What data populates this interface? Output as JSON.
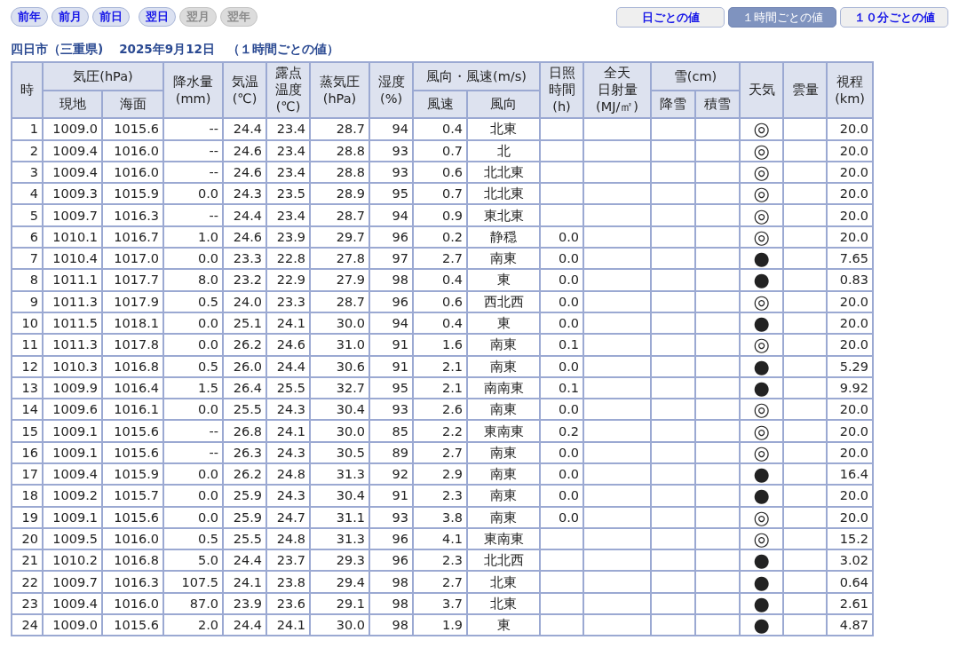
{
  "nav_buttons": [
    {
      "label": "前年",
      "disabled": false
    },
    {
      "label": "前月",
      "disabled": false
    },
    {
      "label": "前日",
      "disabled": false
    },
    {
      "label": "翌日",
      "disabled": false
    },
    {
      "label": "翌月",
      "disabled": true
    },
    {
      "label": "翌年",
      "disabled": true
    }
  ],
  "view_tabs": [
    {
      "label": "日ごとの値",
      "selected": false
    },
    {
      "label": "１時間ごとの値",
      "selected": true
    },
    {
      "label": "１０分ごとの値",
      "selected": false
    }
  ],
  "heading": {
    "station": "四日市（三重県)",
    "date": "2025年9月12日",
    "note": "（１時間ごとの値）"
  },
  "table": {
    "columns": [
      {
        "label": "時"
      },
      {
        "label": "気圧(hPa)",
        "children": [
          {
            "label": "現地"
          },
          {
            "label": "海面"
          }
        ]
      },
      {
        "label": "降水量(mm)"
      },
      {
        "label": "気温(℃)"
      },
      {
        "label": "露点温度(℃)"
      },
      {
        "label": "蒸気圧(hPa)"
      },
      {
        "label": "湿度(%)"
      },
      {
        "label": "風向・風速(m/s)",
        "children": [
          {
            "label": "風速"
          },
          {
            "label": "風向"
          }
        ]
      },
      {
        "label": "日照時間(h)"
      },
      {
        "label": "全天日射量(MJ/㎡)"
      },
      {
        "label": "雪(cm)",
        "children": [
          {
            "label": "降雪"
          },
          {
            "label": "積雪"
          }
        ]
      },
      {
        "label": "天気"
      },
      {
        "label": "雲量"
      },
      {
        "label": "視程(km)"
      }
    ],
    "rows": [
      {
        "hour": "1",
        "p_station": "1009.0",
        "p_sea": "1015.6",
        "precip": "--",
        "temp": "24.4",
        "dew": "23.4",
        "vapor": "28.7",
        "humidity": "94",
        "wind_speed": "0.4",
        "wind_dir": "北東",
        "weather": "◎",
        "visibility": "20.0"
      },
      {
        "hour": "2",
        "p_station": "1009.4",
        "p_sea": "1016.0",
        "precip": "--",
        "temp": "24.6",
        "dew": "23.4",
        "vapor": "28.8",
        "humidity": "93",
        "wind_speed": "0.7",
        "wind_dir": "北",
        "weather": "◎",
        "visibility": "20.0"
      },
      {
        "hour": "3",
        "p_station": "1009.4",
        "p_sea": "1016.0",
        "precip": "--",
        "temp": "24.6",
        "dew": "23.4",
        "vapor": "28.8",
        "humidity": "93",
        "wind_speed": "0.6",
        "wind_dir": "北北東",
        "weather": "◎",
        "visibility": "20.0"
      },
      {
        "hour": "4",
        "p_station": "1009.3",
        "p_sea": "1015.9",
        "precip": "0.0",
        "temp": "24.3",
        "dew": "23.5",
        "vapor": "28.9",
        "humidity": "95",
        "wind_speed": "0.7",
        "wind_dir": "北北東",
        "weather": "◎",
        "visibility": "20.0"
      },
      {
        "hour": "5",
        "p_station": "1009.7",
        "p_sea": "1016.3",
        "precip": "--",
        "temp": "24.4",
        "dew": "23.4",
        "vapor": "28.7",
        "humidity": "94",
        "wind_speed": "0.9",
        "wind_dir": "東北東",
        "weather": "◎",
        "visibility": "20.0"
      },
      {
        "hour": "6",
        "p_station": "1010.1",
        "p_sea": "1016.7",
        "precip": "1.0",
        "temp": "24.6",
        "dew": "23.9",
        "vapor": "29.7",
        "humidity": "96",
        "wind_speed": "0.2",
        "wind_dir": "静穏",
        "sunshine": "0.0",
        "weather": "◎",
        "visibility": "20.0"
      },
      {
        "hour": "7",
        "p_station": "1010.4",
        "p_sea": "1017.0",
        "precip": "0.0",
        "temp": "23.3",
        "dew": "22.8",
        "vapor": "27.8",
        "humidity": "97",
        "wind_speed": "2.7",
        "wind_dir": "南東",
        "sunshine": "0.0",
        "weather": "●",
        "visibility": "7.65"
      },
      {
        "hour": "8",
        "p_station": "1011.1",
        "p_sea": "1017.7",
        "precip": "8.0",
        "temp": "23.2",
        "dew": "22.9",
        "vapor": "27.9",
        "humidity": "98",
        "wind_speed": "0.4",
        "wind_dir": "東",
        "sunshine": "0.0",
        "weather": "●",
        "visibility": "0.83"
      },
      {
        "hour": "9",
        "p_station": "1011.3",
        "p_sea": "1017.9",
        "precip": "0.5",
        "temp": "24.0",
        "dew": "23.3",
        "vapor": "28.7",
        "humidity": "96",
        "wind_speed": "0.6",
        "wind_dir": "西北西",
        "sunshine": "0.0",
        "weather": "◎",
        "visibility": "20.0"
      },
      {
        "hour": "10",
        "p_station": "1011.5",
        "p_sea": "1018.1",
        "precip": "0.0",
        "temp": "25.1",
        "dew": "24.1",
        "vapor": "30.0",
        "humidity": "94",
        "wind_speed": "0.4",
        "wind_dir": "東",
        "sunshine": "0.0",
        "weather": "●",
        "visibility": "20.0"
      },
      {
        "hour": "11",
        "p_station": "1011.3",
        "p_sea": "1017.8",
        "precip": "0.0",
        "temp": "26.2",
        "dew": "24.6",
        "vapor": "31.0",
        "humidity": "91",
        "wind_speed": "1.6",
        "wind_dir": "南東",
        "sunshine": "0.1",
        "weather": "◎",
        "visibility": "20.0"
      },
      {
        "hour": "12",
        "p_station": "1010.3",
        "p_sea": "1016.8",
        "precip": "0.5",
        "temp": "26.0",
        "dew": "24.4",
        "vapor": "30.6",
        "humidity": "91",
        "wind_speed": "2.1",
        "wind_dir": "南東",
        "sunshine": "0.0",
        "weather": "●",
        "visibility": "5.29"
      },
      {
        "hour": "13",
        "p_station": "1009.9",
        "p_sea": "1016.4",
        "precip": "1.5",
        "temp": "26.4",
        "dew": "25.5",
        "vapor": "32.7",
        "humidity": "95",
        "wind_speed": "2.1",
        "wind_dir": "南南東",
        "sunshine": "0.1",
        "weather": "●",
        "visibility": "9.92"
      },
      {
        "hour": "14",
        "p_station": "1009.6",
        "p_sea": "1016.1",
        "precip": "0.0",
        "temp": "25.5",
        "dew": "24.3",
        "vapor": "30.4",
        "humidity": "93",
        "wind_speed": "2.6",
        "wind_dir": "南東",
        "sunshine": "0.0",
        "weather": "◎",
        "visibility": "20.0"
      },
      {
        "hour": "15",
        "p_station": "1009.1",
        "p_sea": "1015.6",
        "precip": "--",
        "temp": "26.8",
        "dew": "24.1",
        "vapor": "30.0",
        "humidity": "85",
        "wind_speed": "2.2",
        "wind_dir": "東南東",
        "sunshine": "0.2",
        "weather": "◎",
        "visibility": "20.0"
      },
      {
        "hour": "16",
        "p_station": "1009.1",
        "p_sea": "1015.6",
        "precip": "--",
        "temp": "26.3",
        "dew": "24.3",
        "vapor": "30.5",
        "humidity": "89",
        "wind_speed": "2.7",
        "wind_dir": "南東",
        "sunshine": "0.0",
        "weather": "◎",
        "visibility": "20.0"
      },
      {
        "hour": "17",
        "p_station": "1009.4",
        "p_sea": "1015.9",
        "precip": "0.0",
        "temp": "26.2",
        "dew": "24.8",
        "vapor": "31.3",
        "humidity": "92",
        "wind_speed": "2.9",
        "wind_dir": "南東",
        "sunshine": "0.0",
        "weather": "●",
        "visibility": "16.4"
      },
      {
        "hour": "18",
        "p_station": "1009.2",
        "p_sea": "1015.7",
        "precip": "0.0",
        "temp": "25.9",
        "dew": "24.3",
        "vapor": "30.4",
        "humidity": "91",
        "wind_speed": "2.3",
        "wind_dir": "南東",
        "sunshine": "0.0",
        "weather": "●",
        "visibility": "20.0"
      },
      {
        "hour": "19",
        "p_station": "1009.1",
        "p_sea": "1015.6",
        "precip": "0.0",
        "temp": "25.9",
        "dew": "24.7",
        "vapor": "31.1",
        "humidity": "93",
        "wind_speed": "3.8",
        "wind_dir": "南東",
        "sunshine": "0.0",
        "weather": "◎",
        "visibility": "20.0"
      },
      {
        "hour": "20",
        "p_station": "1009.5",
        "p_sea": "1016.0",
        "precip": "0.5",
        "temp": "25.5",
        "dew": "24.8",
        "vapor": "31.3",
        "humidity": "96",
        "wind_speed": "4.1",
        "wind_dir": "東南東",
        "weather": "◎",
        "visibility": "15.2"
      },
      {
        "hour": "21",
        "p_station": "1010.2",
        "p_sea": "1016.8",
        "precip": "5.0",
        "temp": "24.4",
        "dew": "23.7",
        "vapor": "29.3",
        "humidity": "96",
        "wind_speed": "2.3",
        "wind_dir": "北北西",
        "weather": "●",
        "visibility": "3.02"
      },
      {
        "hour": "22",
        "p_station": "1009.7",
        "p_sea": "1016.3",
        "precip": "107.5",
        "temp": "24.1",
        "dew": "23.8",
        "vapor": "29.4",
        "humidity": "98",
        "wind_speed": "2.7",
        "wind_dir": "北東",
        "weather": "●",
        "visibility": "0.64"
      },
      {
        "hour": "23",
        "p_station": "1009.4",
        "p_sea": "1016.0",
        "precip": "87.0",
        "temp": "23.9",
        "dew": "23.6",
        "vapor": "29.1",
        "humidity": "98",
        "wind_speed": "3.7",
        "wind_dir": "北東",
        "weather": "●",
        "visibility": "2.61"
      },
      {
        "hour": "24",
        "p_station": "1009.0",
        "p_sea": "1015.6",
        "precip": "2.0",
        "temp": "24.4",
        "dew": "24.1",
        "vapor": "30.0",
        "humidity": "98",
        "wind_speed": "1.9",
        "wind_dir": "東",
        "weather": "●",
        "visibility": "4.87"
      }
    ]
  }
}
